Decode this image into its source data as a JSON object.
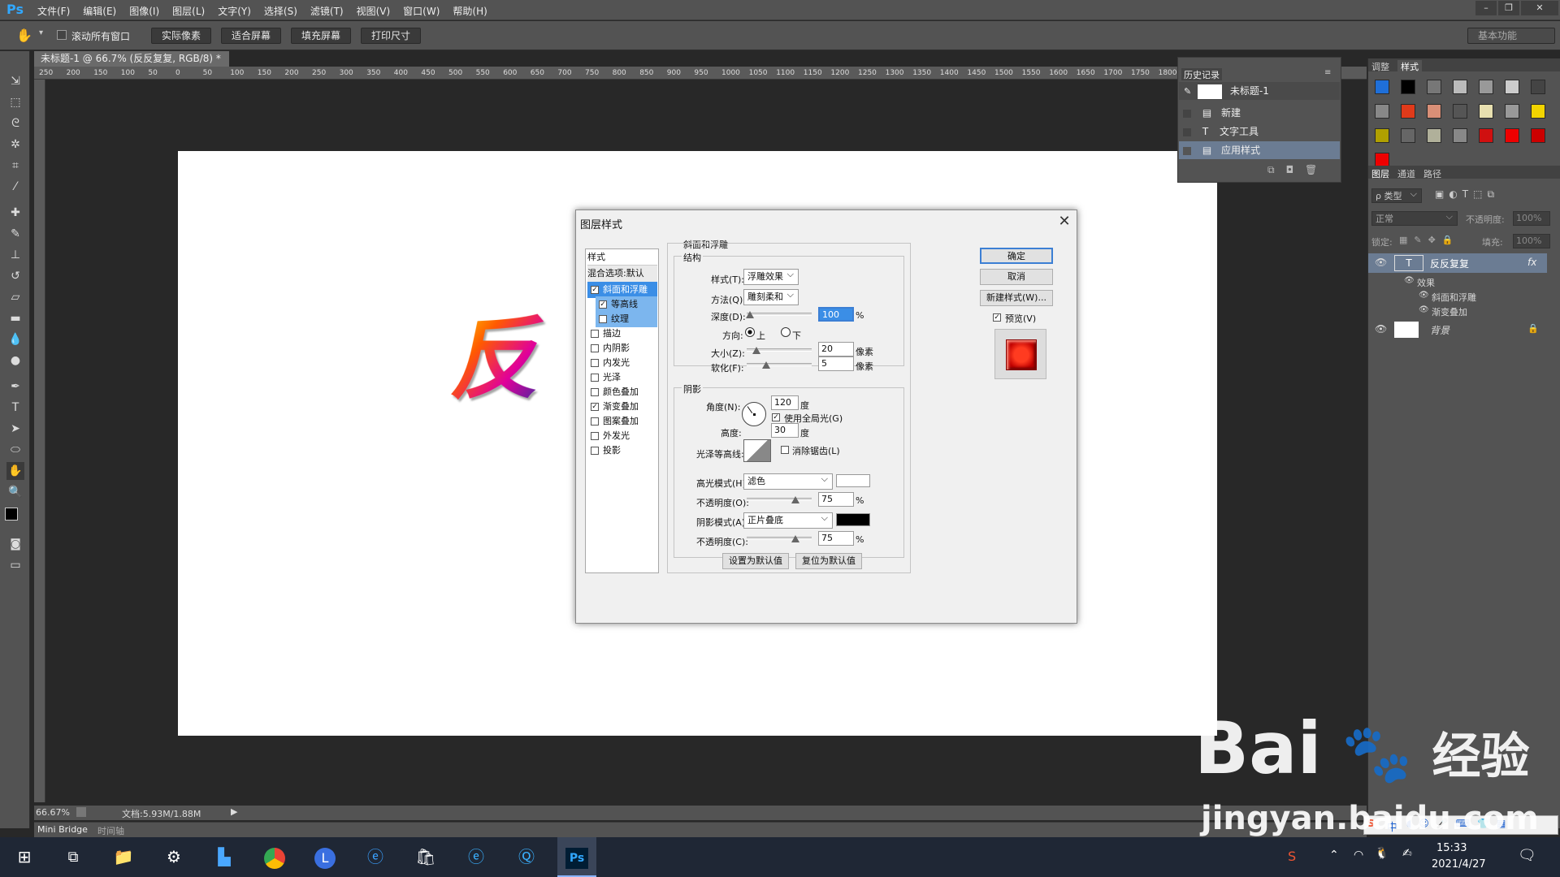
{
  "menubar": {
    "logo": "Ps",
    "items": [
      "文件(F)",
      "编辑(E)",
      "图像(I)",
      "图层(L)",
      "文字(Y)",
      "选择(S)",
      "滤镜(T)",
      "视图(V)",
      "窗口(W)",
      "帮助(H)"
    ]
  },
  "options": {
    "scroll_all": "滚动所有窗口",
    "buttons": [
      "实际像素",
      "适合屏幕",
      "填充屏幕",
      "打印尺寸"
    ],
    "workspace": "基本功能"
  },
  "document": {
    "tab_title": "未标题-1 @ 66.7% (反反复复, RGB/8) *",
    "char": "反",
    "zoom": "66.67%",
    "doc_size": "文档:5.93M/1.88M"
  },
  "ruler": {
    "h_ticks": [
      "250",
      "200",
      "150",
      "100",
      "50",
      "0",
      "50",
      "100",
      "150",
      "200",
      "250",
      "300",
      "350",
      "400",
      "450",
      "500",
      "550",
      "600",
      "650",
      "700",
      "750",
      "800",
      "850",
      "900",
      "950",
      "1000",
      "1050",
      "1100",
      "1150",
      "1200",
      "1250",
      "1300",
      "1350",
      "1400",
      "1450",
      "1500",
      "1550",
      "1600",
      "1650",
      "1700",
      "1750",
      "1800"
    ]
  },
  "bottom_tabs": [
    "Mini Bridge",
    "时间轴"
  ],
  "history": {
    "title": "历史记录",
    "snapshot": "未标题-1",
    "items": [
      "新建",
      "文字工具",
      "应用样式"
    ]
  },
  "right": {
    "top_tabs": [
      "调整",
      "样式"
    ],
    "layer_tabs": [
      "图层",
      "通道",
      "路径"
    ],
    "filter_label": "ρ 类型",
    "blend_mode": "正常",
    "opacity_label": "不透明度:",
    "opacity_value": "100%",
    "lock_label": "锁定:",
    "fill_label": "填充:",
    "fill_value": "100%",
    "layers": {
      "text_layer": "反反复复",
      "fx": "fx",
      "effects": "效果",
      "effect1": "斜面和浮雕",
      "effect2": "渐变叠加",
      "background": "背景"
    },
    "swatch_colors": [
      "#1f6fd8",
      "#000000",
      "#777777",
      "#bbbbbb",
      "#999999",
      "#cccccc",
      "#444444",
      "#888888",
      "#e03a1a",
      "#d98f77",
      "#555555",
      "#e8e0b0",
      "#999999",
      "#f2d400",
      "#b0a000",
      "#666666",
      "#b0b09a",
      "#888888",
      "#d01010",
      "#ee0000",
      "#cc0000",
      "#ee0000"
    ]
  },
  "dialog": {
    "title": "图层样式",
    "list_header": "样式",
    "blend_default": "混合选项:默认",
    "items": [
      {
        "label": "斜面和浮雕",
        "checked": "✓"
      },
      {
        "label": "等高线",
        "checked": "✓"
      },
      {
        "label": "纹理",
        "checked": ""
      },
      {
        "label": "描边",
        "checked": ""
      },
      {
        "label": "内阴影",
        "checked": ""
      },
      {
        "label": "内发光",
        "checked": ""
      },
      {
        "label": "光泽",
        "checked": ""
      },
      {
        "label": "颜色叠加",
        "checked": ""
      },
      {
        "label": "渐变叠加",
        "checked": "✓"
      },
      {
        "label": "图案叠加",
        "checked": ""
      },
      {
        "label": "外发光",
        "checked": ""
      },
      {
        "label": "投影",
        "checked": ""
      }
    ],
    "section": "斜面和浮雕",
    "structure": "结构",
    "style_label": "样式(T):",
    "style_value": "浮雕效果",
    "technique_label": "方法(Q):",
    "technique_value": "雕刻柔和",
    "depth_label": "深度(D):",
    "depth_value": "100",
    "depth_level": 0.05,
    "percent": "%",
    "direction_label": "方向:",
    "dir_up": "上",
    "dir_down": "下",
    "size_label": "大小(Z):",
    "size_value": "20",
    "size_level": 0.15,
    "soften_label": "软化(F):",
    "soften_value": "5",
    "soften_level": 0.3,
    "px": "像素",
    "shading": "阴影",
    "angle_label": "角度(N):",
    "angle_value": "120",
    "deg": "度",
    "global_light": "使用全局光(G)",
    "altitude_label": "高度:",
    "altitude_value": "30",
    "gloss_label": "光泽等高线:",
    "antialias": "消除锯齿(L)",
    "highlight_mode_label": "高光模式(H):",
    "highlight_mode": "滤色",
    "highlight_color": "#ffffff",
    "hl_opacity_label": "不透明度(O):",
    "hl_opacity": "75",
    "hl_level": 0.75,
    "shadow_mode_label": "阴影模式(A):",
    "shadow_mode": "正片叠底",
    "shadow_color": "#000000",
    "sh_opacity_label": "不透明度(C):",
    "sh_opacity": "75",
    "sh_level": 0.75,
    "make_default": "设置为默认值",
    "reset_default": "复位为默认值",
    "ok": "确定",
    "cancel": "取消",
    "new_style": "新建样式(W)...",
    "preview": "预览(V)"
  },
  "taskbar": {
    "ime": "中",
    "time": "15:33",
    "date": "2021/4/27"
  },
  "watermark": {
    "brand": "Bai",
    "brand2": "经验",
    "url": "jingyan.baidu.com"
  }
}
